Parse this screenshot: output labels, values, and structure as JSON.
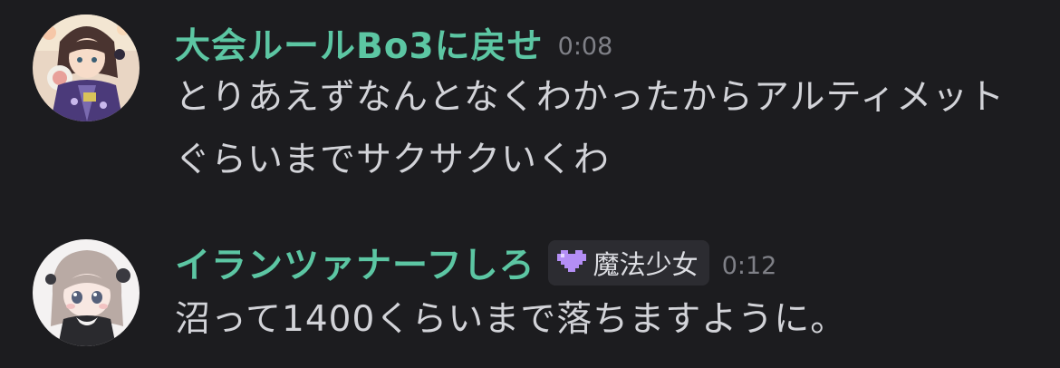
{
  "messages": [
    {
      "username": "大会ルールBo3に戻せ",
      "username_color": "#5cc6a3",
      "timestamp": "0:08",
      "text": "とりあえずなんとなくわかったからアルティメットぐらいまでサクサクいくわ",
      "avatar": "anime-girl-kimono-avatar"
    },
    {
      "username": "イランツァナーフしろ",
      "username_color": "#5cc6a3",
      "badge": {
        "icon": "purple-pixel-heart-icon",
        "label": "魔法少女",
        "color": "#b48ef5"
      },
      "timestamp": "0:12",
      "text": "沼って1400くらいまで落ちますように。",
      "avatar": "chibi-girl-avatar"
    }
  ],
  "colors": {
    "background": "#1c1c1f",
    "message_text": "#d2d3d8",
    "timestamp": "#7f8087",
    "badge_background": "#2c2c31"
  }
}
